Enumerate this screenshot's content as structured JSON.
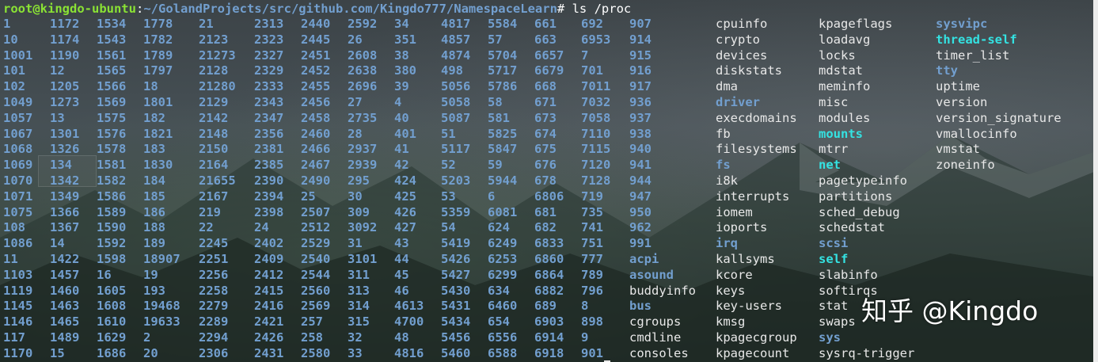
{
  "prompt": {
    "user_host": "root@kingdo-ubuntu",
    "separator": ":",
    "cwd": "~/GolandProjects/src/github.com/Kingdo777/NamespaceLearn",
    "symbol": "#",
    "command": " ls /proc"
  },
  "colors": {
    "prompt_user": "#8ae234",
    "prompt_path": "#729fcf",
    "dir": "#729fcf",
    "link": "#34e2e2",
    "file": "#e8e8e8"
  },
  "listing": [
    [
      [
        "1",
        "d"
      ],
      [
        "1172",
        "d"
      ],
      [
        "1534",
        "d"
      ],
      [
        "1778",
        "d"
      ],
      [
        "21",
        "d"
      ],
      [
        "2313",
        "d"
      ],
      [
        "2440",
        "d"
      ],
      [
        "2592",
        "d"
      ],
      [
        "34",
        "d"
      ],
      [
        "4817",
        "d"
      ],
      [
        "5584",
        "d"
      ],
      [
        "661",
        "d"
      ],
      [
        "692",
        "d"
      ],
      [
        "907",
        "d"
      ],
      [
        "cpuinfo",
        "f"
      ],
      [
        "kpageflags",
        "f"
      ],
      [
        "sysvipc",
        "d"
      ]
    ],
    [
      [
        "10",
        "d"
      ],
      [
        "1174",
        "d"
      ],
      [
        "1543",
        "d"
      ],
      [
        "1782",
        "d"
      ],
      [
        "2123",
        "d"
      ],
      [
        "2323",
        "d"
      ],
      [
        "2445",
        "d"
      ],
      [
        "26",
        "d"
      ],
      [
        "351",
        "d"
      ],
      [
        "4857",
        "d"
      ],
      [
        "57",
        "d"
      ],
      [
        "663",
        "d"
      ],
      [
        "6953",
        "d"
      ],
      [
        "914",
        "d"
      ],
      [
        "crypto",
        "f"
      ],
      [
        "loadavg",
        "f"
      ],
      [
        "thread-self",
        "l"
      ]
    ],
    [
      [
        "1001",
        "d"
      ],
      [
        "1190",
        "d"
      ],
      [
        "1561",
        "d"
      ],
      [
        "1789",
        "d"
      ],
      [
        "21273",
        "d"
      ],
      [
        "2327",
        "d"
      ],
      [
        "2451",
        "d"
      ],
      [
        "2608",
        "d"
      ],
      [
        "38",
        "d"
      ],
      [
        "4874",
        "d"
      ],
      [
        "5704",
        "d"
      ],
      [
        "6657",
        "d"
      ],
      [
        "7",
        "d"
      ],
      [
        "915",
        "d"
      ],
      [
        "devices",
        "f"
      ],
      [
        "locks",
        "f"
      ],
      [
        "timer_list",
        "f"
      ]
    ],
    [
      [
        "101",
        "d"
      ],
      [
        "12",
        "d"
      ],
      [
        "1565",
        "d"
      ],
      [
        "1797",
        "d"
      ],
      [
        "2128",
        "d"
      ],
      [
        "2329",
        "d"
      ],
      [
        "2452",
        "d"
      ],
      [
        "2638",
        "d"
      ],
      [
        "380",
        "d"
      ],
      [
        "498",
        "d"
      ],
      [
        "5717",
        "d"
      ],
      [
        "6679",
        "d"
      ],
      [
        "701",
        "d"
      ],
      [
        "916",
        "d"
      ],
      [
        "diskstats",
        "f"
      ],
      [
        "mdstat",
        "f"
      ],
      [
        "tty",
        "d"
      ]
    ],
    [
      [
        "102",
        "d"
      ],
      [
        "1205",
        "d"
      ],
      [
        "1566",
        "d"
      ],
      [
        "18",
        "d"
      ],
      [
        "21280",
        "d"
      ],
      [
        "2333",
        "d"
      ],
      [
        "2455",
        "d"
      ],
      [
        "2696",
        "d"
      ],
      [
        "39",
        "d"
      ],
      [
        "5056",
        "d"
      ],
      [
        "5786",
        "d"
      ],
      [
        "668",
        "d"
      ],
      [
        "7011",
        "d"
      ],
      [
        "917",
        "d"
      ],
      [
        "dma",
        "f"
      ],
      [
        "meminfo",
        "f"
      ],
      [
        "uptime",
        "f"
      ]
    ],
    [
      [
        "1049",
        "d"
      ],
      [
        "1273",
        "d"
      ],
      [
        "1569",
        "d"
      ],
      [
        "1801",
        "d"
      ],
      [
        "2129",
        "d"
      ],
      [
        "2343",
        "d"
      ],
      [
        "2456",
        "d"
      ],
      [
        "27",
        "d"
      ],
      [
        "4",
        "d"
      ],
      [
        "5058",
        "d"
      ],
      [
        "58",
        "d"
      ],
      [
        "671",
        "d"
      ],
      [
        "7032",
        "d"
      ],
      [
        "936",
        "d"
      ],
      [
        "driver",
        "d"
      ],
      [
        "misc",
        "f"
      ],
      [
        "version",
        "f"
      ]
    ],
    [
      [
        "1057",
        "d"
      ],
      [
        "13",
        "d"
      ],
      [
        "1575",
        "d"
      ],
      [
        "182",
        "d"
      ],
      [
        "2142",
        "d"
      ],
      [
        "2347",
        "d"
      ],
      [
        "2458",
        "d"
      ],
      [
        "2735",
        "d"
      ],
      [
        "40",
        "d"
      ],
      [
        "5087",
        "d"
      ],
      [
        "581",
        "d"
      ],
      [
        "673",
        "d"
      ],
      [
        "7058",
        "d"
      ],
      [
        "937",
        "d"
      ],
      [
        "execdomains",
        "f"
      ],
      [
        "modules",
        "f"
      ],
      [
        "version_signature",
        "f"
      ]
    ],
    [
      [
        "1067",
        "d"
      ],
      [
        "1301",
        "d"
      ],
      [
        "1576",
        "d"
      ],
      [
        "1821",
        "d"
      ],
      [
        "2148",
        "d"
      ],
      [
        "2356",
        "d"
      ],
      [
        "2460",
        "d"
      ],
      [
        "28",
        "d"
      ],
      [
        "401",
        "d"
      ],
      [
        "51",
        "d"
      ],
      [
        "5825",
        "d"
      ],
      [
        "674",
        "d"
      ],
      [
        "7110",
        "d"
      ],
      [
        "938",
        "d"
      ],
      [
        "fb",
        "f"
      ],
      [
        "mounts",
        "l"
      ],
      [
        "vmallocinfo",
        "f"
      ]
    ],
    [
      [
        "1068",
        "d"
      ],
      [
        "1326",
        "d"
      ],
      [
        "1578",
        "d"
      ],
      [
        "183",
        "d"
      ],
      [
        "2150",
        "d"
      ],
      [
        "2381",
        "d"
      ],
      [
        "2466",
        "d"
      ],
      [
        "2937",
        "d"
      ],
      [
        "41",
        "d"
      ],
      [
        "5117",
        "d"
      ],
      [
        "5847",
        "d"
      ],
      [
        "675",
        "d"
      ],
      [
        "7115",
        "d"
      ],
      [
        "940",
        "d"
      ],
      [
        "filesystems",
        "f"
      ],
      [
        "mtrr",
        "f"
      ],
      [
        "vmstat",
        "f"
      ]
    ],
    [
      [
        "1069",
        "d"
      ],
      [
        "134",
        "d"
      ],
      [
        "1581",
        "d"
      ],
      [
        "1830",
        "d"
      ],
      [
        "2164",
        "d"
      ],
      [
        "2385",
        "d"
      ],
      [
        "2467",
        "d"
      ],
      [
        "2939",
        "d"
      ],
      [
        "42",
        "d"
      ],
      [
        "52",
        "d"
      ],
      [
        "59",
        "d"
      ],
      [
        "676",
        "d"
      ],
      [
        "7120",
        "d"
      ],
      [
        "941",
        "d"
      ],
      [
        "fs",
        "d"
      ],
      [
        "net",
        "l"
      ],
      [
        "zoneinfo",
        "f"
      ]
    ],
    [
      [
        "1070",
        "d"
      ],
      [
        "1342",
        "d"
      ],
      [
        "1582",
        "d"
      ],
      [
        "184",
        "d"
      ],
      [
        "21655",
        "d"
      ],
      [
        "2390",
        "d"
      ],
      [
        "2490",
        "d"
      ],
      [
        "295",
        "d"
      ],
      [
        "424",
        "d"
      ],
      [
        "5203",
        "d"
      ],
      [
        "5944",
        "d"
      ],
      [
        "678",
        "d"
      ],
      [
        "7128",
        "d"
      ],
      [
        "944",
        "d"
      ],
      [
        "i8k",
        "f"
      ],
      [
        "pagetypeinfo",
        "f"
      ]
    ],
    [
      [
        "1071",
        "d"
      ],
      [
        "1349",
        "d"
      ],
      [
        "1586",
        "d"
      ],
      [
        "185",
        "d"
      ],
      [
        "2167",
        "d"
      ],
      [
        "2394",
        "d"
      ],
      [
        "25",
        "d"
      ],
      [
        "30",
        "d"
      ],
      [
        "425",
        "d"
      ],
      [
        "53",
        "d"
      ],
      [
        "6",
        "d"
      ],
      [
        "6806",
        "d"
      ],
      [
        "719",
        "d"
      ],
      [
        "947",
        "d"
      ],
      [
        "interrupts",
        "f"
      ],
      [
        "partitions",
        "f"
      ]
    ],
    [
      [
        "1075",
        "d"
      ],
      [
        "1366",
        "d"
      ],
      [
        "1589",
        "d"
      ],
      [
        "186",
        "d"
      ],
      [
        "219",
        "d"
      ],
      [
        "2398",
        "d"
      ],
      [
        "2507",
        "d"
      ],
      [
        "309",
        "d"
      ],
      [
        "426",
        "d"
      ],
      [
        "5359",
        "d"
      ],
      [
        "6081",
        "d"
      ],
      [
        "681",
        "d"
      ],
      [
        "735",
        "d"
      ],
      [
        "950",
        "d"
      ],
      [
        "iomem",
        "f"
      ],
      [
        "sched_debug",
        "f"
      ]
    ],
    [
      [
        "108",
        "d"
      ],
      [
        "1367",
        "d"
      ],
      [
        "1590",
        "d"
      ],
      [
        "188",
        "d"
      ],
      [
        "22",
        "d"
      ],
      [
        "24",
        "d"
      ],
      [
        "2512",
        "d"
      ],
      [
        "3092",
        "d"
      ],
      [
        "427",
        "d"
      ],
      [
        "54",
        "d"
      ],
      [
        "624",
        "d"
      ],
      [
        "682",
        "d"
      ],
      [
        "741",
        "d"
      ],
      [
        "962",
        "d"
      ],
      [
        "ioports",
        "f"
      ],
      [
        "schedstat",
        "f"
      ]
    ],
    [
      [
        "1086",
        "d"
      ],
      [
        "14",
        "d"
      ],
      [
        "1592",
        "d"
      ],
      [
        "189",
        "d"
      ],
      [
        "2245",
        "d"
      ],
      [
        "2402",
        "d"
      ],
      [
        "2529",
        "d"
      ],
      [
        "31",
        "d"
      ],
      [
        "43",
        "d"
      ],
      [
        "5419",
        "d"
      ],
      [
        "6249",
        "d"
      ],
      [
        "6833",
        "d"
      ],
      [
        "751",
        "d"
      ],
      [
        "991",
        "d"
      ],
      [
        "irq",
        "d"
      ],
      [
        "scsi",
        "d"
      ]
    ],
    [
      [
        "11",
        "d"
      ],
      [
        "1422",
        "d"
      ],
      [
        "1598",
        "d"
      ],
      [
        "18907",
        "d"
      ],
      [
        "2251",
        "d"
      ],
      [
        "2409",
        "d"
      ],
      [
        "2540",
        "d"
      ],
      [
        "3101",
        "d"
      ],
      [
        "44",
        "d"
      ],
      [
        "5426",
        "d"
      ],
      [
        "6253",
        "d"
      ],
      [
        "6860",
        "d"
      ],
      [
        "777",
        "d"
      ],
      [
        "acpi",
        "d"
      ],
      [
        "kallsyms",
        "f"
      ],
      [
        "self",
        "l"
      ]
    ],
    [
      [
        "1103",
        "d"
      ],
      [
        "1457",
        "d"
      ],
      [
        "16",
        "d"
      ],
      [
        "19",
        "d"
      ],
      [
        "2256",
        "d"
      ],
      [
        "2412",
        "d"
      ],
      [
        "2544",
        "d"
      ],
      [
        "311",
        "d"
      ],
      [
        "45",
        "d"
      ],
      [
        "5427",
        "d"
      ],
      [
        "6299",
        "d"
      ],
      [
        "6864",
        "d"
      ],
      [
        "789",
        "d"
      ],
      [
        "asound",
        "d"
      ],
      [
        "kcore",
        "f"
      ],
      [
        "slabinfo",
        "f"
      ]
    ],
    [
      [
        "1119",
        "d"
      ],
      [
        "1460",
        "d"
      ],
      [
        "1605",
        "d"
      ],
      [
        "193",
        "d"
      ],
      [
        "2258",
        "d"
      ],
      [
        "2415",
        "d"
      ],
      [
        "2560",
        "d"
      ],
      [
        "313",
        "d"
      ],
      [
        "46",
        "d"
      ],
      [
        "5430",
        "d"
      ],
      [
        "634",
        "d"
      ],
      [
        "6882",
        "d"
      ],
      [
        "796",
        "d"
      ],
      [
        "buddyinfo",
        "f"
      ],
      [
        "keys",
        "f"
      ],
      [
        "softirqs",
        "f"
      ]
    ],
    [
      [
        "1145",
        "d"
      ],
      [
        "1463",
        "d"
      ],
      [
        "1608",
        "d"
      ],
      [
        "19468",
        "d"
      ],
      [
        "2279",
        "d"
      ],
      [
        "2416",
        "d"
      ],
      [
        "2569",
        "d"
      ],
      [
        "314",
        "d"
      ],
      [
        "4613",
        "d"
      ],
      [
        "5431",
        "d"
      ],
      [
        "6460",
        "d"
      ],
      [
        "689",
        "d"
      ],
      [
        "8",
        "d"
      ],
      [
        "bus",
        "d"
      ],
      [
        "key-users",
        "f"
      ],
      [
        "stat",
        "f"
      ]
    ],
    [
      [
        "1146",
        "d"
      ],
      [
        "1465",
        "d"
      ],
      [
        "1610",
        "d"
      ],
      [
        "19633",
        "d"
      ],
      [
        "2289",
        "d"
      ],
      [
        "2421",
        "d"
      ],
      [
        "257",
        "d"
      ],
      [
        "315",
        "d"
      ],
      [
        "4700",
        "d"
      ],
      [
        "5434",
        "d"
      ],
      [
        "654",
        "d"
      ],
      [
        "6903",
        "d"
      ],
      [
        "898",
        "d"
      ],
      [
        "cgroups",
        "f"
      ],
      [
        "kmsg",
        "f"
      ],
      [
        "swaps",
        "f"
      ]
    ],
    [
      [
        "117",
        "d"
      ],
      [
        "1489",
        "d"
      ],
      [
        "1629",
        "d"
      ],
      [
        "2",
        "d"
      ],
      [
        "2294",
        "d"
      ],
      [
        "2426",
        "d"
      ],
      [
        "258",
        "d"
      ],
      [
        "32",
        "d"
      ],
      [
        "48",
        "d"
      ],
      [
        "5456",
        "d"
      ],
      [
        "6556",
        "d"
      ],
      [
        "6914",
        "d"
      ],
      [
        "9",
        "d"
      ],
      [
        "cmdline",
        "f"
      ],
      [
        "kpagecgroup",
        "f"
      ],
      [
        "sys",
        "d"
      ]
    ],
    [
      [
        "1170",
        "d"
      ],
      [
        "15",
        "d"
      ],
      [
        "1686",
        "d"
      ],
      [
        "20",
        "d"
      ],
      [
        "2306",
        "d"
      ],
      [
        "2431",
        "d"
      ],
      [
        "2580",
        "d"
      ],
      [
        "33",
        "d"
      ],
      [
        "4816",
        "d"
      ],
      [
        "5460",
        "d"
      ],
      [
        "6588",
        "d"
      ],
      [
        "6918",
        "d"
      ],
      [
        "901",
        "d"
      ],
      [
        "consoles",
        "f"
      ],
      [
        "kpagecount",
        "f"
      ],
      [
        "sysrq-trigger",
        "f"
      ]
    ]
  ],
  "watermark": "知乎 @Kingdo"
}
